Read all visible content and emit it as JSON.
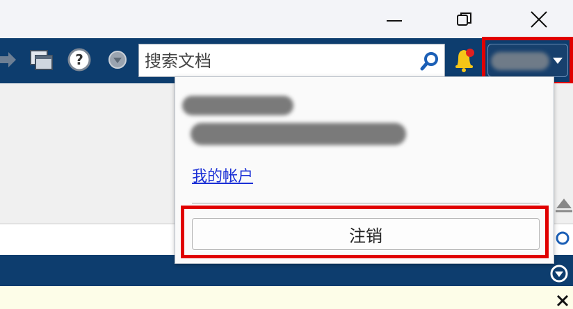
{
  "window_controls": {
    "minimize_icon": "minimize-icon",
    "restore_icon": "restore-icon",
    "close_icon": "close-icon"
  },
  "toolbar": {
    "icons": [
      "forward-icon",
      "windows-icon",
      "help-icon",
      "dropdown-circle-icon"
    ],
    "search": {
      "placeholder": "搜索文档"
    },
    "notification_icon": "bell-icon",
    "user_menu_icon": "caret-down-icon"
  },
  "user_dropdown": {
    "my_account_label": "我的帐户",
    "logout_label": "注销"
  },
  "colors": {
    "toolbar": "#0d3d6e",
    "highlight": "#e00000",
    "link": "#1a2fd6"
  }
}
